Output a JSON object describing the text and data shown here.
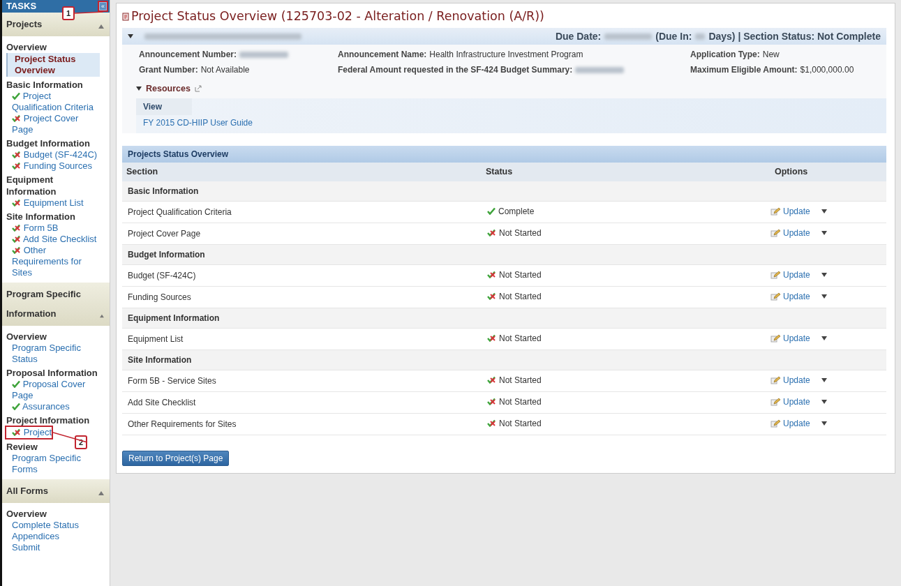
{
  "sidebar": {
    "title": "TASKS",
    "collapse_label": "«",
    "sections": [
      {
        "title": "Projects",
        "expanded": true,
        "items": [
          {
            "kind": "heading",
            "text": "Overview"
          },
          {
            "kind": "link",
            "text": "Project Status Overview",
            "selected": true
          },
          {
            "kind": "heading",
            "text": "Basic Information"
          },
          {
            "kind": "link",
            "text": "Project Qualification Criteria",
            "complete": true,
            "selected": false
          },
          {
            "kind": "link",
            "text": "Project Cover Page",
            "complete": false,
            "selected": false
          },
          {
            "kind": "heading",
            "text": "Budget Information"
          },
          {
            "kind": "link",
            "text": "Budget (SF-424C)",
            "complete": false,
            "selected": false
          },
          {
            "kind": "link",
            "text": "Funding Sources",
            "complete": false,
            "selected": false
          },
          {
            "kind": "heading",
            "text": "Equipment Information"
          },
          {
            "kind": "link",
            "text": "Equipment List",
            "complete": false,
            "selected": false
          },
          {
            "kind": "heading",
            "text": "Site Information"
          },
          {
            "kind": "link",
            "text": "Form 5B",
            "complete": false,
            "selected": false
          },
          {
            "kind": "link",
            "text": "Add Site Checklist",
            "complete": false,
            "selected": false
          },
          {
            "kind": "link",
            "text": "Other Requirements for Sites",
            "complete": false,
            "selected": false
          }
        ]
      },
      {
        "title": "Program Specific Information",
        "expanded": true,
        "items": [
          {
            "kind": "heading",
            "text": "Overview"
          },
          {
            "kind": "link",
            "text": "Program Specific Status",
            "selected": false
          },
          {
            "kind": "heading",
            "text": "Proposal Information"
          },
          {
            "kind": "link",
            "text": "Proposal Cover Page",
            "complete": true,
            "selected": false
          },
          {
            "kind": "link",
            "text": "Assurances",
            "complete": true,
            "selected": false
          },
          {
            "kind": "heading",
            "text": "Project Information"
          },
          {
            "kind": "link",
            "text": "Project",
            "complete": false,
            "selected": false,
            "callout": "2"
          },
          {
            "kind": "heading",
            "text": "Review"
          },
          {
            "kind": "link",
            "text": "Program Specific Forms",
            "selected": false
          }
        ]
      },
      {
        "title": "All Forms",
        "expanded": true,
        "items": [
          {
            "kind": "heading",
            "text": "Overview"
          },
          {
            "kind": "link",
            "text": "Complete Status",
            "selected": false
          },
          {
            "kind": "link",
            "text": "Appendices",
            "selected": false
          },
          {
            "kind": "link",
            "text": "Submit",
            "selected": false
          }
        ]
      }
    ],
    "collapse_callout": "1"
  },
  "page_title": "Project Status Overview (125703-02 - Alteration / Renovation (A/R))",
  "info_panel": {
    "expanded": true,
    "due_parts": [
      "Due Date:",
      "(Due In:",
      "Days) | Section Status: Not Complete"
    ],
    "fields": [
      {
        "label": "Announcement Number:"
      },
      {
        "label": "Announcement Name:",
        "value": "Health Infrastructure Investment Program"
      },
      {
        "label": "Application Type:",
        "value": "New"
      },
      {
        "label": "Grant Number:",
        "value": "Not Available"
      },
      {
        "label": "Federal Amount requested in the SF-424 Budget Summary:"
      },
      {
        "label": "Maximum Eligible Amount:",
        "value": "$1,000,000.00"
      }
    ],
    "resources": {
      "title": "Resources",
      "expanded": true,
      "column": "View",
      "links": [
        "FY 2015 CD-HIIP User Guide"
      ]
    }
  },
  "status_table": {
    "title": "Projects Status Overview",
    "columns": [
      "Section",
      "Status",
      "Options"
    ],
    "rows": [
      {
        "kind": "group",
        "section": "Basic Information"
      },
      {
        "kind": "item",
        "section": "Project Qualification Criteria",
        "complete": true,
        "status_text": "Complete",
        "option": "Update"
      },
      {
        "kind": "item",
        "section": "Project Cover Page",
        "complete": false,
        "status_text": "Not Started",
        "option": "Update"
      },
      {
        "kind": "group",
        "section": "Budget Information"
      },
      {
        "kind": "item",
        "section": "Budget (SF-424C)",
        "complete": false,
        "status_text": "Not Started",
        "option": "Update"
      },
      {
        "kind": "item",
        "section": "Funding Sources",
        "complete": false,
        "status_text": "Not Started",
        "option": "Update"
      },
      {
        "kind": "group",
        "section": "Equipment Information"
      },
      {
        "kind": "item",
        "section": "Equipment List",
        "complete": false,
        "status_text": "Not Started",
        "option": "Update"
      },
      {
        "kind": "group",
        "section": "Site Information"
      },
      {
        "kind": "item",
        "section": "Form 5B - Service Sites",
        "complete": false,
        "status_text": "Not Started",
        "option": "Update"
      },
      {
        "kind": "item",
        "section": "Add Site Checklist",
        "complete": false,
        "status_text": "Not Started",
        "option": "Update"
      },
      {
        "kind": "item",
        "section": "Other Requirements for Sites",
        "complete": false,
        "status_text": "Not Started",
        "option": "Update"
      }
    ]
  },
  "return_button": "Return to Project(s) Page"
}
